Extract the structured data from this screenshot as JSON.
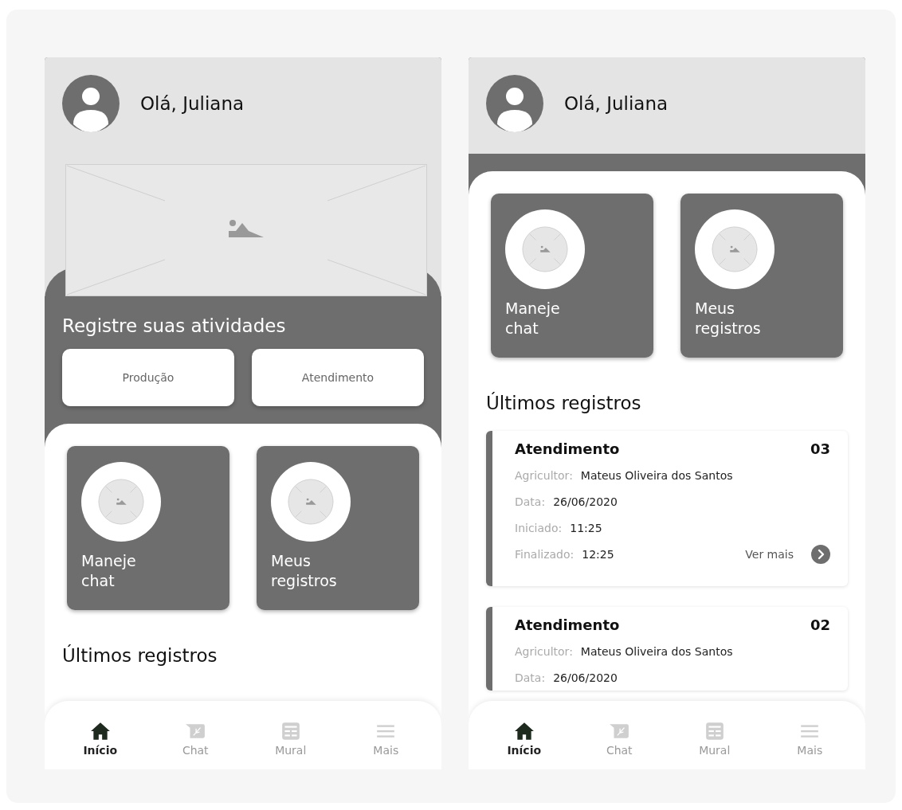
{
  "screens": [
    {
      "greeting": "Olá, Juliana",
      "banner": true,
      "activities": {
        "title": "Registre suas atividades",
        "buttons": [
          "Produção",
          "Atendimento"
        ]
      },
      "tiles": [
        "Maneje chat",
        "Meus registros"
      ],
      "records_title": "Últimos registros",
      "nav": [
        {
          "kind": "home",
          "label": "Início",
          "selected": true
        },
        {
          "kind": "chat",
          "label": "Chat",
          "selected": false
        },
        {
          "kind": "mural",
          "label": "Mural",
          "selected": false
        },
        {
          "kind": "menu",
          "label": "Mais",
          "selected": false
        }
      ]
    },
    {
      "greeting": "Olá, Juliana",
      "tiles": [
        "Maneje chat",
        "Meus registros"
      ],
      "records_title": "Últimos registros",
      "records": [
        {
          "title": "Atendimento",
          "number": "03",
          "fields": [
            {
              "label": "Agricultor:",
              "value": "Mateus Oliveira dos Santos"
            },
            {
              "label": "Data:",
              "value": "26/06/2020"
            },
            {
              "label": "Iniciado:",
              "value": "11:25"
            },
            {
              "label": "Finalizado:",
              "value": "12:25"
            }
          ],
          "link": "Ver mais"
        },
        {
          "title": "Atendimento",
          "number": "02",
          "fields": [
            {
              "label": "Agricultor:",
              "value": "Mateus Oliveira dos Santos"
            },
            {
              "label": "Data:",
              "value": "26/06/2020"
            }
          ]
        }
      ],
      "nav": [
        {
          "kind": "home",
          "label": "Início",
          "selected": true
        },
        {
          "kind": "chat",
          "label": "Chat",
          "selected": false
        },
        {
          "kind": "mural",
          "label": "Mural",
          "selected": false
        },
        {
          "kind": "menu",
          "label": "Mais",
          "selected": false
        }
      ]
    }
  ]
}
